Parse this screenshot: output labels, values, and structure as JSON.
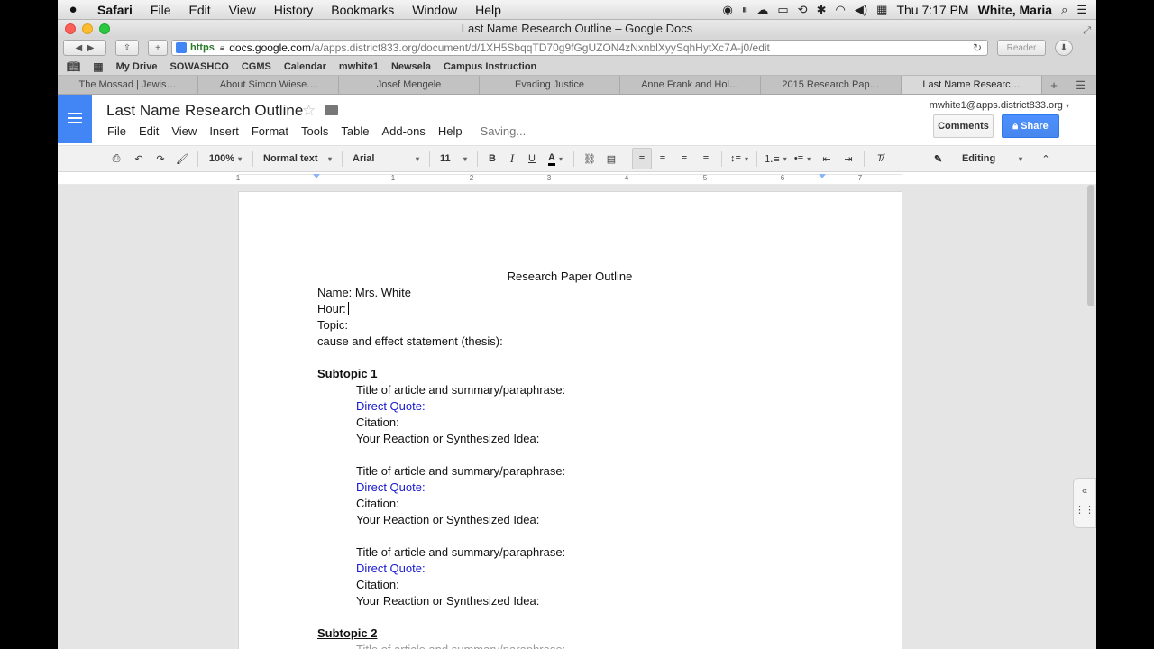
{
  "mac_menu": {
    "apple": "",
    "items": [
      "Safari",
      "File",
      "Edit",
      "View",
      "History",
      "Bookmarks",
      "Window",
      "Help"
    ],
    "clock": "Thu 7:17 PM",
    "user": "White, Maria"
  },
  "window": {
    "title": "Last Name Research Outline – Google Docs"
  },
  "browser": {
    "url_scheme": "https",
    "url_host": "docs.google.com",
    "url_path": "/a/apps.district833.org/document/d/1XH5SbqqTD70g9fGgUZON4zNxnblXyySqhHytXc7A-j0/edit",
    "reader_label": "Reader",
    "bookmarks": [
      "My Drive",
      "SOWASHCO",
      "CGMS",
      "Calendar",
      "mwhite1",
      "Newsela",
      "Campus Instruction"
    ],
    "tabs": [
      "The Mossad | Jewis…",
      "About Simon Wiese…",
      "Josef Mengele",
      "Evading Justice",
      "Anne Frank and Hol…",
      "2015 Research Pap…",
      "Last Name Researc…"
    ],
    "active_tab_index": 6
  },
  "docs": {
    "title": "Last Name Research Outline",
    "menus": [
      "File",
      "Edit",
      "View",
      "Insert",
      "Format",
      "Tools",
      "Table",
      "Add-ons",
      "Help"
    ],
    "status": "Saving...",
    "account": "mwhite1@apps.district833.org",
    "comments_label": "Comments",
    "share_label": "Share",
    "toolbar": {
      "zoom": "100%",
      "style": "Normal text",
      "font": "Arial",
      "size": "11",
      "bold": "B",
      "italic": "I",
      "underline": "U",
      "text_color": "A",
      "mode": "Editing"
    },
    "ruler_numbers": [
      "1",
      "1",
      "2",
      "3",
      "4",
      "5",
      "6",
      "7"
    ]
  },
  "document": {
    "heading": "Research Paper Outline",
    "name_line": "Name: Mrs. White",
    "hour_line": "Hour:",
    "topic_line": "Topic:",
    "thesis_line": "cause and effect statement (thesis):",
    "subtopic1": "Subtopic 1",
    "subtopic2": "Subtopic 2",
    "entry": {
      "title": "Title of article and summary/paraphrase:",
      "quote": "Direct Quote:",
      "citation": "Citation:",
      "reaction": "Your Reaction or Synthesized Idea:"
    }
  },
  "colors": {
    "docs_blue": "#4285f4",
    "share_blue": "#4787ed",
    "quote_blue": "#1a1acd"
  }
}
